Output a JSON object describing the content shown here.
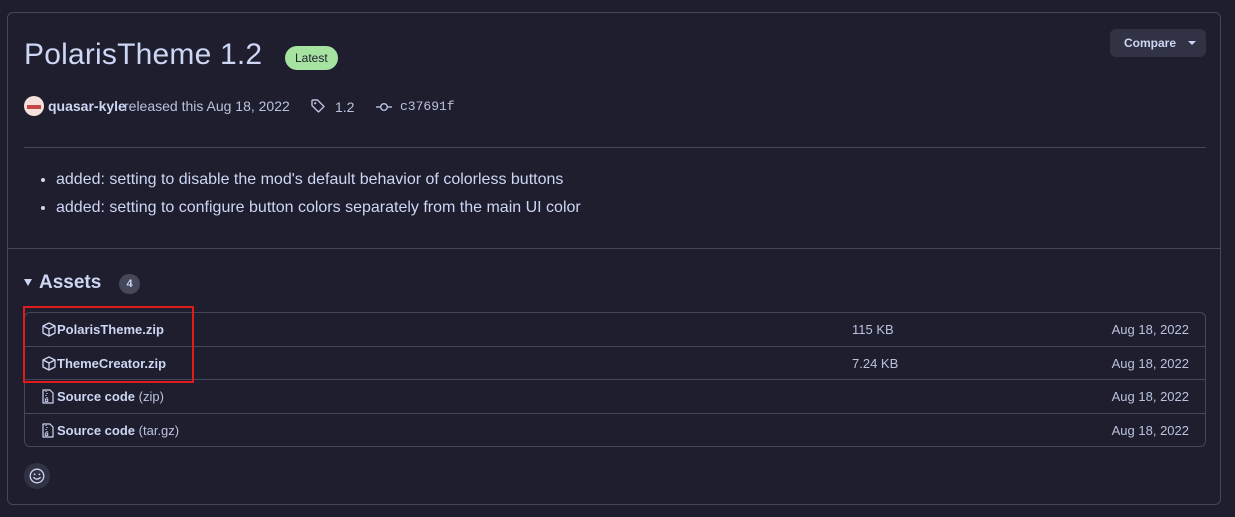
{
  "release": {
    "title": "PolarisTheme 1.2",
    "latest_badge": "Latest",
    "compare_label": "Compare",
    "author": "quasar-kyle",
    "released_text": "released this Aug 18, 2022",
    "tag": "1.2",
    "commit": "c37691f",
    "notes": [
      "added: setting to disable the mod's default behavior of colorless buttons",
      "added: setting to configure button colors separately from the main UI color"
    ]
  },
  "assets": {
    "title": "Assets",
    "count": "4",
    "items": [
      {
        "name": "PolarisTheme.zip",
        "suffix": "",
        "size": "115 KB",
        "date": "Aug 18, 2022",
        "icon": "package-icon"
      },
      {
        "name": "ThemeCreator.zip",
        "suffix": "",
        "size": "7.24 KB",
        "date": "Aug 18, 2022",
        "icon": "package-icon"
      },
      {
        "name": "Source code",
        "suffix": "(zip)",
        "size": "",
        "date": "Aug 18, 2022",
        "icon": "file-zip-icon"
      },
      {
        "name": "Source code",
        "suffix": "(tar.gz)",
        "size": "",
        "date": "Aug 18, 2022",
        "icon": "file-zip-icon"
      }
    ]
  },
  "colors": {
    "background": "#1e1e2e",
    "text": "#cdd6f4",
    "latest_badge": "#a6e3a1",
    "highlight_box": "#e01b1b"
  }
}
